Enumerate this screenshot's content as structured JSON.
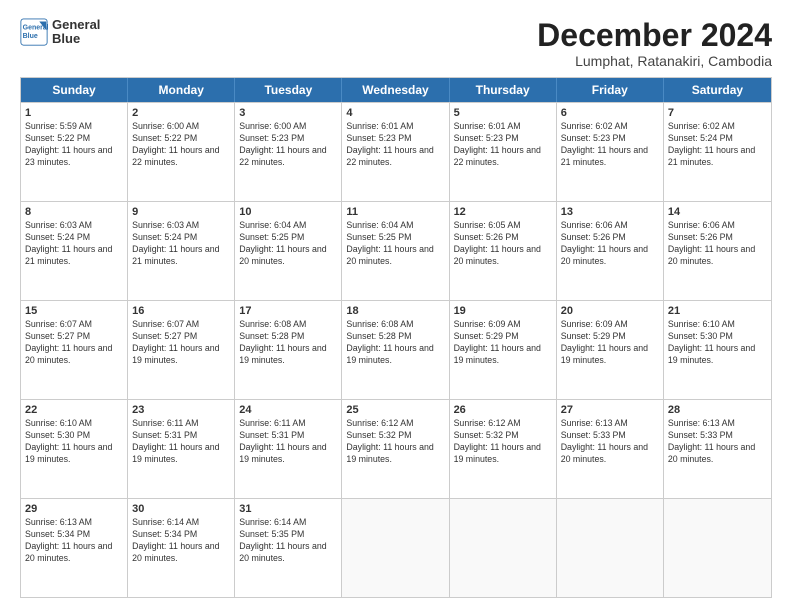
{
  "logo": {
    "line1": "General",
    "line2": "Blue"
  },
  "title": "December 2024",
  "location": "Lumphat, Ratanakiri, Cambodia",
  "days_of_week": [
    "Sunday",
    "Monday",
    "Tuesday",
    "Wednesday",
    "Thursday",
    "Friday",
    "Saturday"
  ],
  "weeks": [
    [
      {
        "day": "1",
        "rise": "Sunrise: 5:59 AM",
        "set": "Sunset: 5:22 PM",
        "daylight": "Daylight: 11 hours and 23 minutes."
      },
      {
        "day": "2",
        "rise": "Sunrise: 6:00 AM",
        "set": "Sunset: 5:22 PM",
        "daylight": "Daylight: 11 hours and 22 minutes."
      },
      {
        "day": "3",
        "rise": "Sunrise: 6:00 AM",
        "set": "Sunset: 5:23 PM",
        "daylight": "Daylight: 11 hours and 22 minutes."
      },
      {
        "day": "4",
        "rise": "Sunrise: 6:01 AM",
        "set": "Sunset: 5:23 PM",
        "daylight": "Daylight: 11 hours and 22 minutes."
      },
      {
        "day": "5",
        "rise": "Sunrise: 6:01 AM",
        "set": "Sunset: 5:23 PM",
        "daylight": "Daylight: 11 hours and 22 minutes."
      },
      {
        "day": "6",
        "rise": "Sunrise: 6:02 AM",
        "set": "Sunset: 5:23 PM",
        "daylight": "Daylight: 11 hours and 21 minutes."
      },
      {
        "day": "7",
        "rise": "Sunrise: 6:02 AM",
        "set": "Sunset: 5:24 PM",
        "daylight": "Daylight: 11 hours and 21 minutes."
      }
    ],
    [
      {
        "day": "8",
        "rise": "Sunrise: 6:03 AM",
        "set": "Sunset: 5:24 PM",
        "daylight": "Daylight: 11 hours and 21 minutes."
      },
      {
        "day": "9",
        "rise": "Sunrise: 6:03 AM",
        "set": "Sunset: 5:24 PM",
        "daylight": "Daylight: 11 hours and 21 minutes."
      },
      {
        "day": "10",
        "rise": "Sunrise: 6:04 AM",
        "set": "Sunset: 5:25 PM",
        "daylight": "Daylight: 11 hours and 20 minutes."
      },
      {
        "day": "11",
        "rise": "Sunrise: 6:04 AM",
        "set": "Sunset: 5:25 PM",
        "daylight": "Daylight: 11 hours and 20 minutes."
      },
      {
        "day": "12",
        "rise": "Sunrise: 6:05 AM",
        "set": "Sunset: 5:26 PM",
        "daylight": "Daylight: 11 hours and 20 minutes."
      },
      {
        "day": "13",
        "rise": "Sunrise: 6:06 AM",
        "set": "Sunset: 5:26 PM",
        "daylight": "Daylight: 11 hours and 20 minutes."
      },
      {
        "day": "14",
        "rise": "Sunrise: 6:06 AM",
        "set": "Sunset: 5:26 PM",
        "daylight": "Daylight: 11 hours and 20 minutes."
      }
    ],
    [
      {
        "day": "15",
        "rise": "Sunrise: 6:07 AM",
        "set": "Sunset: 5:27 PM",
        "daylight": "Daylight: 11 hours and 20 minutes."
      },
      {
        "day": "16",
        "rise": "Sunrise: 6:07 AM",
        "set": "Sunset: 5:27 PM",
        "daylight": "Daylight: 11 hours and 19 minutes."
      },
      {
        "day": "17",
        "rise": "Sunrise: 6:08 AM",
        "set": "Sunset: 5:28 PM",
        "daylight": "Daylight: 11 hours and 19 minutes."
      },
      {
        "day": "18",
        "rise": "Sunrise: 6:08 AM",
        "set": "Sunset: 5:28 PM",
        "daylight": "Daylight: 11 hours and 19 minutes."
      },
      {
        "day": "19",
        "rise": "Sunrise: 6:09 AM",
        "set": "Sunset: 5:29 PM",
        "daylight": "Daylight: 11 hours and 19 minutes."
      },
      {
        "day": "20",
        "rise": "Sunrise: 6:09 AM",
        "set": "Sunset: 5:29 PM",
        "daylight": "Daylight: 11 hours and 19 minutes."
      },
      {
        "day": "21",
        "rise": "Sunrise: 6:10 AM",
        "set": "Sunset: 5:30 PM",
        "daylight": "Daylight: 11 hours and 19 minutes."
      }
    ],
    [
      {
        "day": "22",
        "rise": "Sunrise: 6:10 AM",
        "set": "Sunset: 5:30 PM",
        "daylight": "Daylight: 11 hours and 19 minutes."
      },
      {
        "day": "23",
        "rise": "Sunrise: 6:11 AM",
        "set": "Sunset: 5:31 PM",
        "daylight": "Daylight: 11 hours and 19 minutes."
      },
      {
        "day": "24",
        "rise": "Sunrise: 6:11 AM",
        "set": "Sunset: 5:31 PM",
        "daylight": "Daylight: 11 hours and 19 minutes."
      },
      {
        "day": "25",
        "rise": "Sunrise: 6:12 AM",
        "set": "Sunset: 5:32 PM",
        "daylight": "Daylight: 11 hours and 19 minutes."
      },
      {
        "day": "26",
        "rise": "Sunrise: 6:12 AM",
        "set": "Sunset: 5:32 PM",
        "daylight": "Daylight: 11 hours and 19 minutes."
      },
      {
        "day": "27",
        "rise": "Sunrise: 6:13 AM",
        "set": "Sunset: 5:33 PM",
        "daylight": "Daylight: 11 hours and 20 minutes."
      },
      {
        "day": "28",
        "rise": "Sunrise: 6:13 AM",
        "set": "Sunset: 5:33 PM",
        "daylight": "Daylight: 11 hours and 20 minutes."
      }
    ],
    [
      {
        "day": "29",
        "rise": "Sunrise: 6:13 AM",
        "set": "Sunset: 5:34 PM",
        "daylight": "Daylight: 11 hours and 20 minutes."
      },
      {
        "day": "30",
        "rise": "Sunrise: 6:14 AM",
        "set": "Sunset: 5:34 PM",
        "daylight": "Daylight: 11 hours and 20 minutes."
      },
      {
        "day": "31",
        "rise": "Sunrise: 6:14 AM",
        "set": "Sunset: 5:35 PM",
        "daylight": "Daylight: 11 hours and 20 minutes."
      },
      {
        "day": "",
        "rise": "",
        "set": "",
        "daylight": ""
      },
      {
        "day": "",
        "rise": "",
        "set": "",
        "daylight": ""
      },
      {
        "day": "",
        "rise": "",
        "set": "",
        "daylight": ""
      },
      {
        "day": "",
        "rise": "",
        "set": "",
        "daylight": ""
      }
    ]
  ]
}
